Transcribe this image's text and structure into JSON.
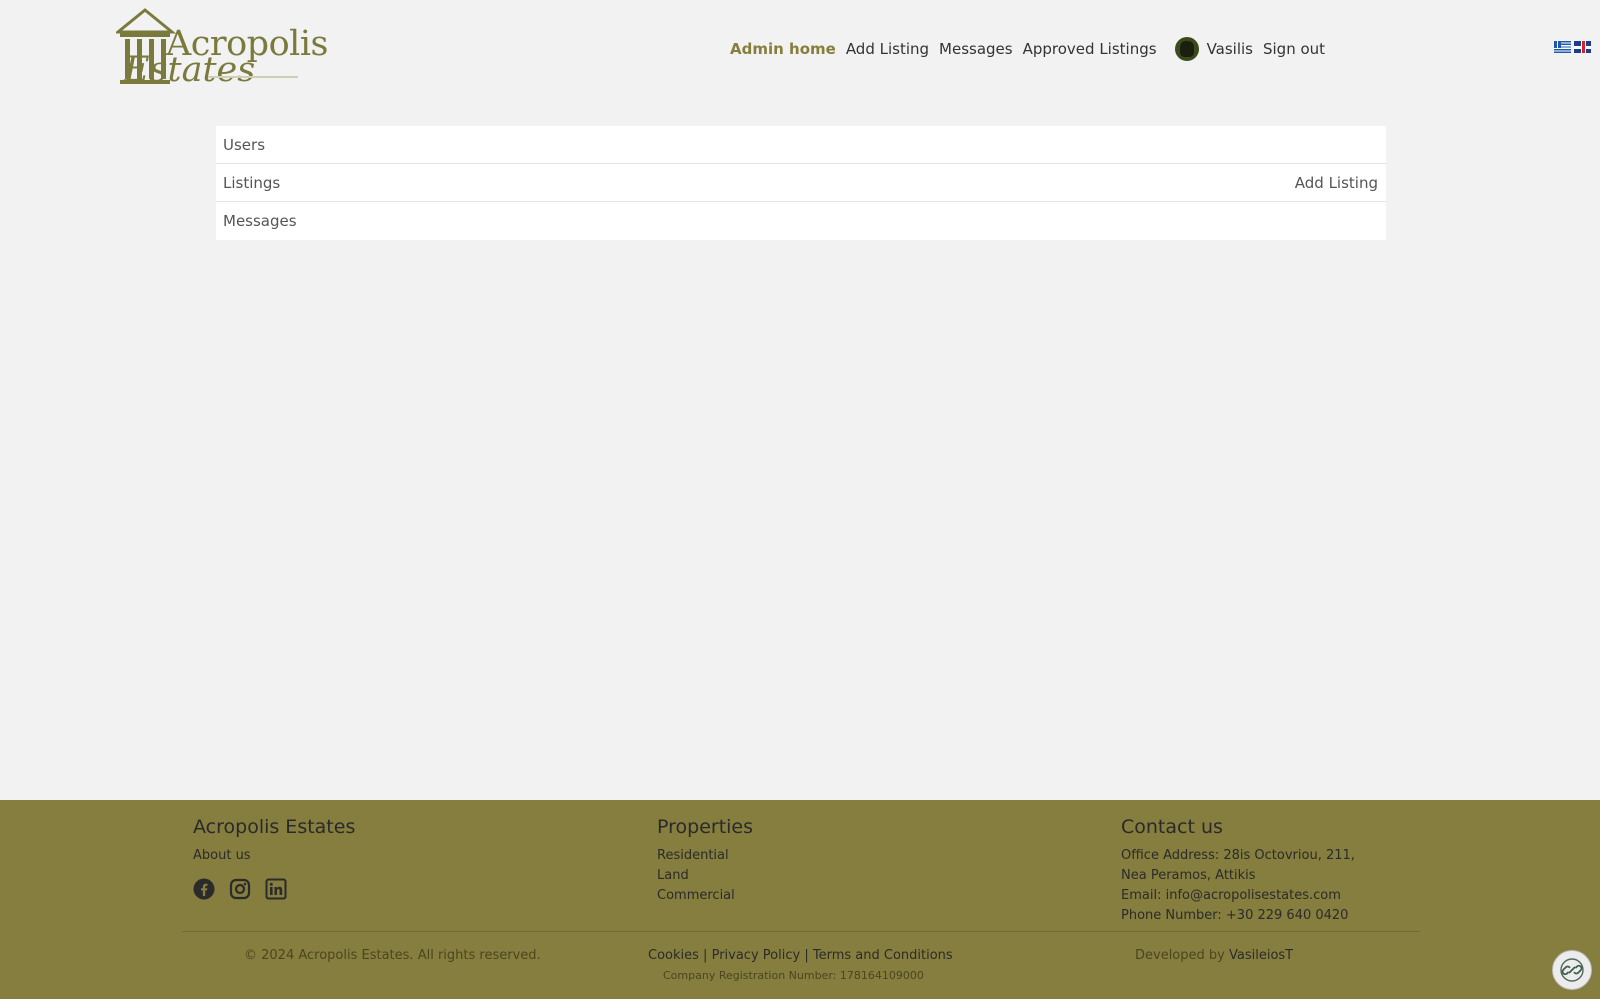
{
  "header": {
    "logo_line1": "Acropolis",
    "logo_line2": "Estates",
    "nav": {
      "admin_home": "Admin home",
      "add_listing": "Add Listing",
      "messages": "Messages",
      "approved_listings": "Approved Listings",
      "user_name": "Vasilis",
      "sign_out": "Sign out"
    }
  },
  "panel": {
    "users": "Users",
    "listings": "Listings",
    "add_listing": "Add Listing",
    "messages": "Messages"
  },
  "footer": {
    "col1": {
      "title": "Acropolis Estates",
      "about": "About us"
    },
    "col2": {
      "title": "Properties",
      "items": [
        "Residential",
        "Land",
        "Commercial"
      ]
    },
    "col3": {
      "title": "Contact us",
      "address_1": "Office Address: 28is Octovriou, 211,",
      "address_2": "Nea Peramos, Attikis",
      "email_label": "Email: ",
      "email": "info@acropolisestates.com",
      "phone": "Phone Number: +30 229 640 0420"
    },
    "copyright": "© 2024 Acropolis Estates. All rights reserved.",
    "cookies": "Cookies",
    "privacy": "Privacy Policy",
    "terms": "Terms and Conditions",
    "separator": "|",
    "reg_number": "Company Registration Number: 178164109000",
    "developed_by": "Developed by ",
    "developer": "VasileiosT"
  },
  "colors": {
    "accent": "#857e3c",
    "footer_bg": "#857e3e",
    "page_bg": "#f2f2f2"
  }
}
